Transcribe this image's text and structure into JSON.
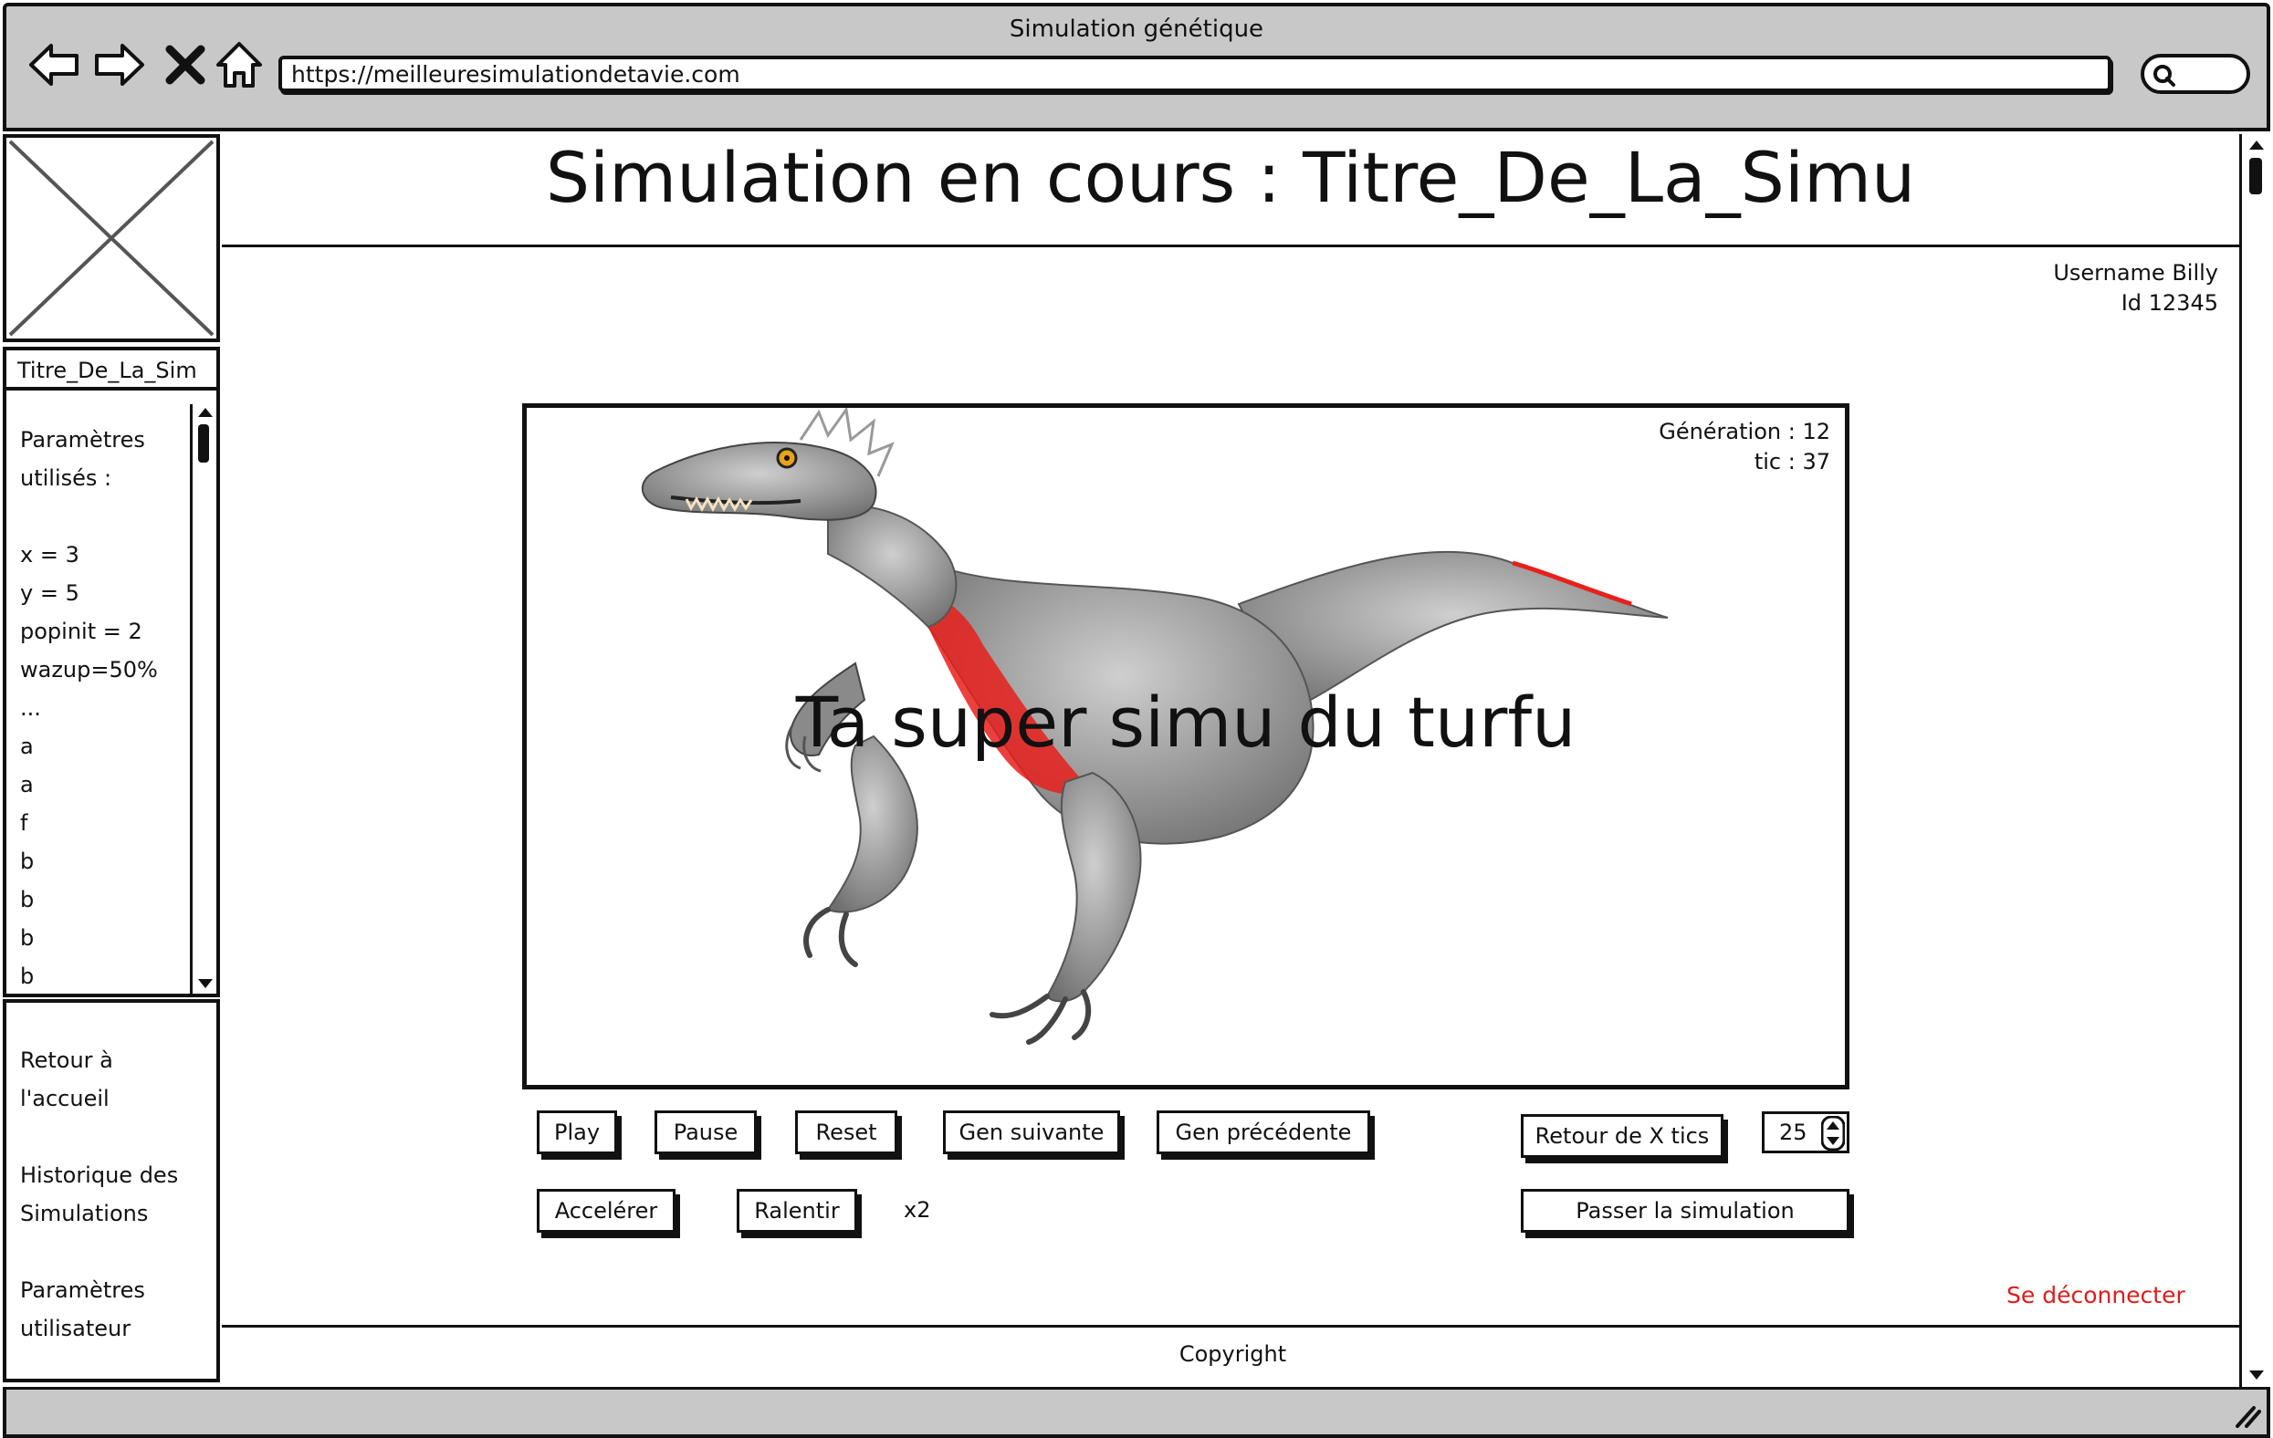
{
  "browser": {
    "window_title": "Simulation génétique",
    "url": "https://meilleuresimulationdetavie.com",
    "nav_icons": [
      "back-arrow-icon",
      "forward-arrow-icon",
      "close-icon",
      "home-icon",
      "search-icon"
    ]
  },
  "sidebar": {
    "sim_tab_label": "Titre_De_La_Sim",
    "params_heading_1": "Paramètres",
    "params_heading_2": "utilisés :",
    "params": [
      "x = 3",
      "y = 5",
      "popinit = 2",
      "wazup=50%",
      "...",
      "a",
      "a",
      "f",
      "b",
      "b",
      "b",
      "b"
    ],
    "menu": {
      "home_1": "Retour à",
      "home_2": "l'accueil",
      "history_1": "Historique des",
      "history_2": "Simulations",
      "settings_1": "Paramètres",
      "settings_2": "utilisateur"
    }
  },
  "header": {
    "title": "Simulation en cours : Titre_De_La_Simu"
  },
  "user": {
    "username": "Username Billy",
    "id": "Id 12345"
  },
  "simulation": {
    "generation": "Génération : 12",
    "tic": "tic : 37",
    "overlay_text": "Ta super simu du turfu"
  },
  "controls": {
    "play": "Play",
    "pause": "Pause",
    "reset": "Reset",
    "next_gen": "Gen suivante",
    "prev_gen": "Gen précédente",
    "back_x_tics": "Retour de X tics",
    "stepper_value": "25",
    "speed_up": "Accelérer",
    "slow_down": "Ralentir",
    "speed_label": "x2",
    "skip": "Passer la simulation"
  },
  "footer": {
    "logout": "Se déconnecter",
    "copyright": "Copyright"
  },
  "colors": {
    "chrome_gray": "#c8c8c8",
    "logout_red": "#e01b1b",
    "dino_accent": "#e8201c"
  }
}
